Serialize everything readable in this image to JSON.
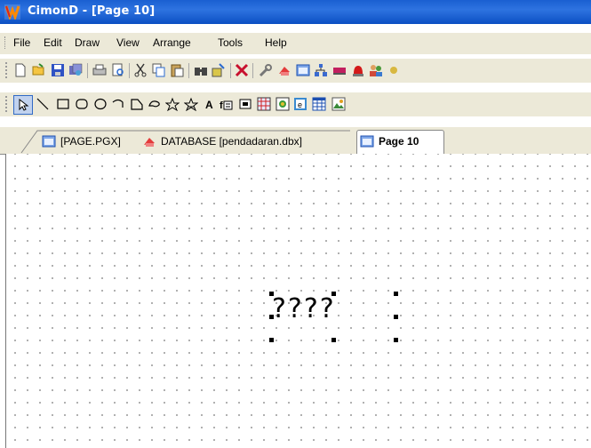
{
  "window": {
    "title": "CimonD - [Page 10]"
  },
  "menu": [
    "File",
    "Edit",
    "Draw",
    "View",
    "Arrange",
    "Tools",
    "Help"
  ],
  "toolbar1": [
    "new-file-icon",
    "open-folder-icon",
    "save-icon",
    "save-all-icon",
    "print-icon",
    "print-preview-icon",
    "cut-icon",
    "copy-icon",
    "paste-icon",
    "find-icon",
    "find-replace-icon",
    "delete-icon",
    "tools-icon",
    "database-icon",
    "page-icon",
    "network-icon",
    "ram-icon",
    "alarm-icon",
    "users-icon",
    "more-icon"
  ],
  "toolbar2": [
    "select-arrow-icon",
    "line-icon",
    "rectangle-icon",
    "rounded-rect-icon",
    "ellipse-icon",
    "arc-icon",
    "polygon-icon",
    "freeform-icon",
    "star-outline-icon",
    "star-icon",
    "text-icon",
    "text-object-icon",
    "button-object-icon",
    "grid-object-icon",
    "bitmap-object-icon",
    "text-box-icon",
    "table-icon",
    "picture-icon"
  ],
  "tabs": [
    {
      "label": "[PAGE.PGX]",
      "icon": "page-icon",
      "active": false
    },
    {
      "label": "DATABASE [pendadaran.dbx]",
      "icon": "database-icon",
      "active": false
    },
    {
      "label": "Page 10",
      "icon": "page-icon",
      "active": true
    }
  ],
  "canvas": {
    "text_object": "????"
  },
  "colors": {
    "titlebar": "#2e73e0",
    "chrome": "#ece9d8",
    "canvas": "#ffffff"
  }
}
